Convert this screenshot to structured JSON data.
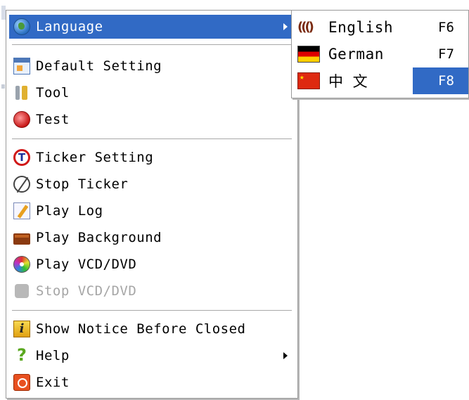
{
  "menu": {
    "items": [
      {
        "label": "Language",
        "icon": "globe-icon",
        "has_submenu": true,
        "active": true
      },
      {
        "label": "Default Setting",
        "icon": "settings-window-icon"
      },
      {
        "label": "Tool",
        "icon": "tools-icon"
      },
      {
        "label": "Test",
        "icon": "test-icon"
      },
      {
        "label": "Ticker Setting",
        "icon": "ticker-icon"
      },
      {
        "label": "Stop Ticker",
        "icon": "stop-ticker-icon"
      },
      {
        "label": "Play Log",
        "icon": "log-icon"
      },
      {
        "label": "Play Background",
        "icon": "background-icon"
      },
      {
        "label": "Play VCD/DVD",
        "icon": "dvd-icon"
      },
      {
        "label": "Stop VCD/DVD",
        "icon": "stop-dvd-icon",
        "disabled": true
      },
      {
        "label": "Show Notice Before Closed",
        "icon": "info-icon"
      },
      {
        "label": "Help",
        "icon": "help-icon",
        "has_submenu": true
      },
      {
        "label": "Exit",
        "icon": "exit-icon"
      }
    ]
  },
  "submenu": {
    "items": [
      {
        "label": "English",
        "shortcut": "F6",
        "icon": "english-flag-icon"
      },
      {
        "label": "German",
        "shortcut": "F7",
        "icon": "german-flag-icon"
      },
      {
        "label": "中 文",
        "shortcut": "F8",
        "icon": "china-flag-icon",
        "highlighted": true
      }
    ]
  },
  "colors": {
    "highlight": "#316ac5",
    "disabled_text": "#a6a6a6",
    "border": "#9a9a9a"
  }
}
